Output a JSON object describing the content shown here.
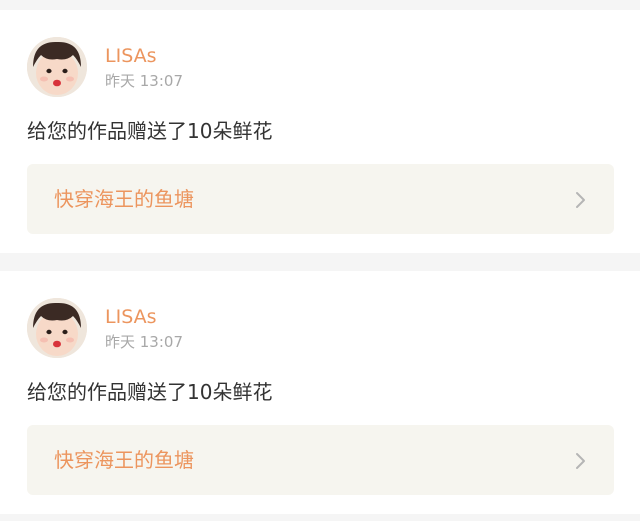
{
  "notifications": [
    {
      "user": "LISAs",
      "time": "昨天 13:07",
      "message": "给您的作品赠送了10朵鲜花",
      "work_title": "快穿海王的鱼塘",
      "icons": {
        "avatar": "user-avatar-photo",
        "chevron": "chevron-right-icon"
      }
    },
    {
      "user": "LISAs",
      "time": "昨天 13:07",
      "message": "给您的作品赠送了10朵鲜花",
      "work_title": "快穿海王的鱼塘",
      "icons": {
        "avatar": "user-avatar-photo",
        "chevron": "chevron-right-icon"
      }
    }
  ],
  "colors": {
    "accent": "#ec955e",
    "muted_text": "#a8a8a8",
    "body_text": "#333333",
    "link_background": "#f6f5ef",
    "page_background": "#f5f5f5"
  }
}
